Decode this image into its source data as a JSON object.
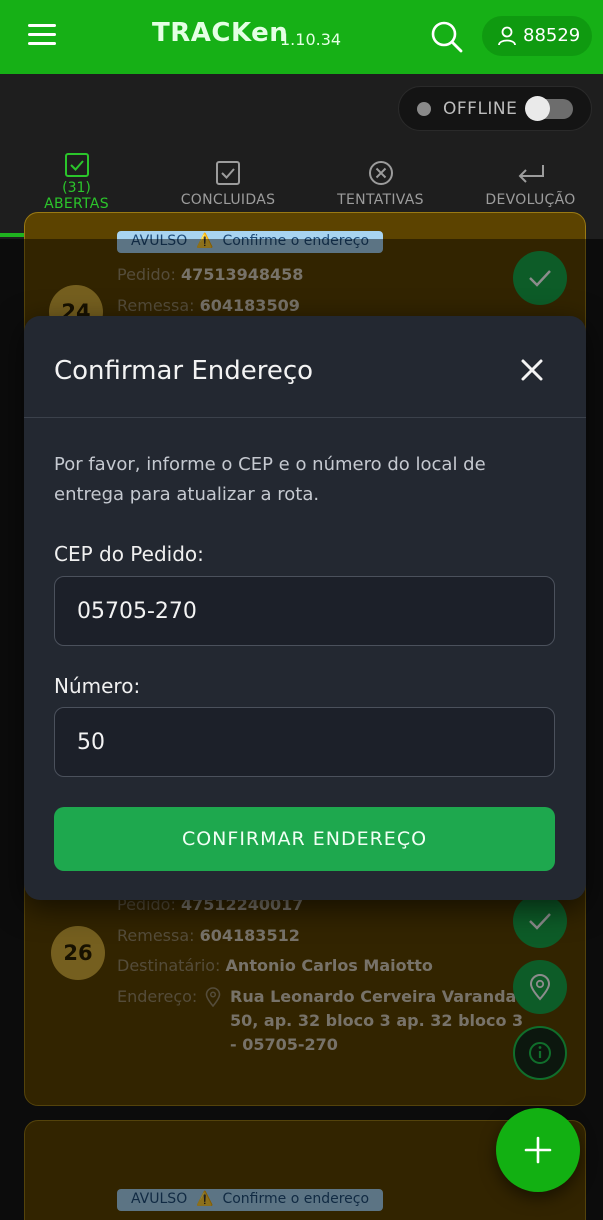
{
  "app": {
    "name": "TRACKen",
    "version": "1.10.34",
    "user_id": "88529"
  },
  "icons": {
    "menu": "hamburger-icon",
    "search": "search-icon",
    "user": "user-icon",
    "close": "close-icon",
    "check": "check-icon",
    "pin": "location-pin-icon",
    "info": "info-icon",
    "warning": "warning-icon",
    "add": "plus-icon"
  },
  "status": {
    "label": "OFFLINE",
    "enabled": false
  },
  "tabs": [
    {
      "count": "(31)",
      "label": "ABERTAS",
      "active": true
    },
    {
      "label": "CONCLUIDAS"
    },
    {
      "label": "TENTATIVAS"
    },
    {
      "label": "DEVOLUÇÃO"
    }
  ],
  "cards": [
    {
      "number": "24",
      "badge_type": "AVULSO",
      "badge_warning": "Confirme o endereço",
      "pedido_label": "Pedido:",
      "pedido": "47513948458",
      "remessa_label": "Remessa:",
      "remessa": "604183509"
    },
    {
      "number": "26",
      "pedido_label": "Pedido:",
      "pedido": "47512240017",
      "remessa_label": "Remessa:",
      "remessa": "604183512",
      "destinatario_label": "Destinatário:",
      "destinatario": "Antonio Carlos Maiotto",
      "endereco_label": "Endereço:",
      "endereco_lines": [
        "Rua Leonardo Cerveira Varandas",
        "50, ap. 32 bloco 3 ap. 32 bloco 3",
        "- 05705-270"
      ]
    },
    {
      "badge_type": "AVULSO",
      "badge_warning": "Confirme o endereço"
    }
  ],
  "modal": {
    "title": "Confirmar Endereço",
    "description": "Por favor, informe o CEP e o número do local de entrega para atualizar a rota.",
    "cep_label": "CEP do Pedido:",
    "cep_value": "05705-270",
    "numero_label": "Número:",
    "numero_value": "50",
    "confirm_label": "CONFIRMAR ENDEREÇO"
  },
  "colors": {
    "brand_green": "#16b016",
    "card_bg": "#5c4300",
    "modal_bg": "#232831",
    "button_green": "#1ea84e"
  }
}
